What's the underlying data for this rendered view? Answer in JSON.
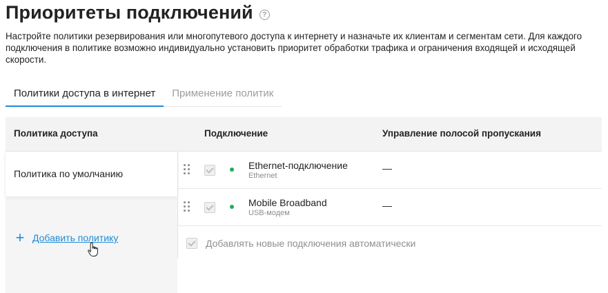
{
  "page": {
    "title": "Приоритеты подключений",
    "help_symbol": "?",
    "description": "Настройте политики резервирования или многопутевого доступа к интернету и назначьте их клиентам и сегментам сети. Для каждого подключения в политике возможно индивидуально установить приоритет обработки трафика и ограничения входящей и исходящей скорости."
  },
  "tabs": [
    {
      "label": "Политики доступа в интернет",
      "active": true
    },
    {
      "label": "Применение политик",
      "active": false
    }
  ],
  "table": {
    "headers": {
      "policy": "Политика доступа",
      "connection": "Подключение",
      "bandwidth": "Управление полосой пропускания"
    },
    "policies": [
      {
        "label": "Политика по умолчанию"
      }
    ],
    "add_policy_label": "Добавить политику",
    "connections": [
      {
        "name": "Ethernet-подключение",
        "type": "Ethernet",
        "checked": true,
        "status_color": "#1fae55",
        "bandwidth": "—"
      },
      {
        "name": "Mobile Broadband",
        "type": "USB-модем",
        "checked": true,
        "status_color": "#1fae55",
        "bandwidth": "—"
      }
    ],
    "auto_add_label": "Добавлять новые подключения автоматически"
  },
  "colors": {
    "accent": "#1f8bd6",
    "status_online": "#1fae55"
  }
}
